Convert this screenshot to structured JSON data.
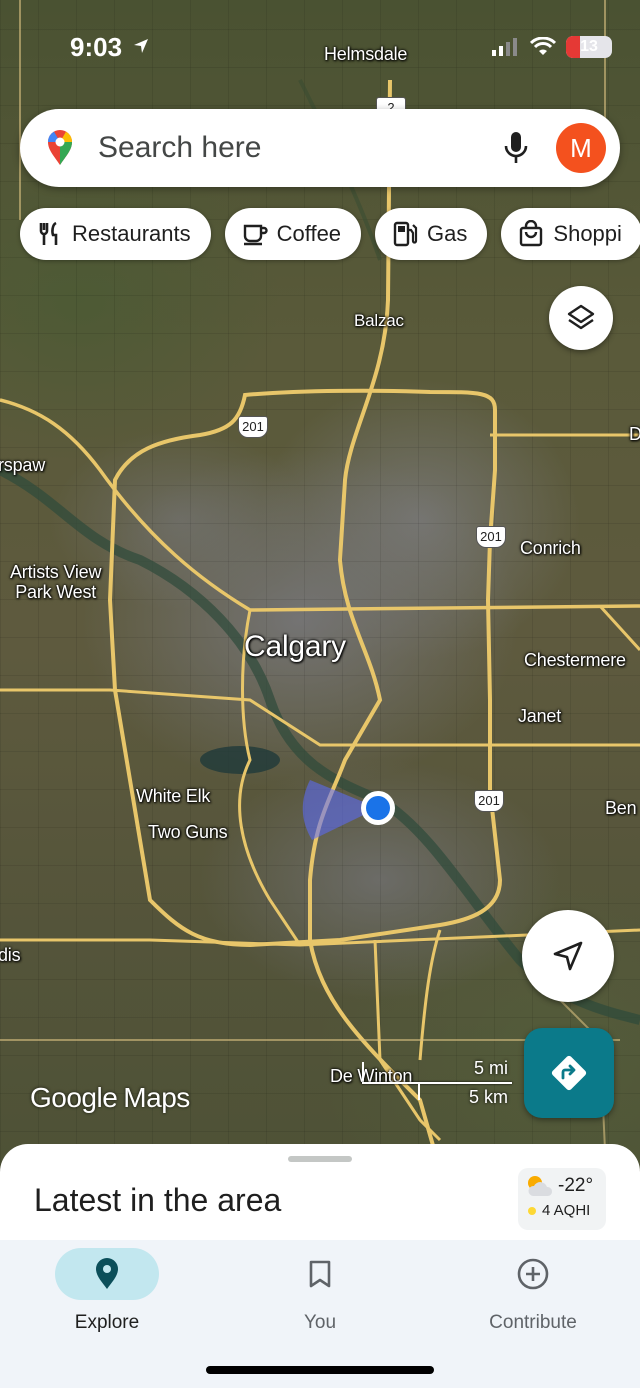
{
  "status_bar": {
    "time": "9:03",
    "battery": "13",
    "icons": [
      "location-arrow-icon",
      "signal-icon",
      "wifi-icon",
      "battery-icon"
    ]
  },
  "search": {
    "placeholder": "Search here",
    "avatar_letter": "M",
    "avatar_color": "#f4511e"
  },
  "chips": [
    {
      "label": "Restaurants",
      "icon": "restaurant-icon"
    },
    {
      "label": "Coffee",
      "icon": "coffee-icon"
    },
    {
      "label": "Gas",
      "icon": "gas-station-icon"
    },
    {
      "label": "Shoppi",
      "icon": "shopping-bag-icon"
    }
  ],
  "map": {
    "labels": {
      "helmsdale": "Helmsdale",
      "balzac": "Balzac",
      "arspaw": "rspaw",
      "conrich": "Conrich",
      "artists_view": "Artists View",
      "park_west": "Park West",
      "calgary": "Calgary",
      "chestermere": "Chestermere",
      "janet": "Janet",
      "white_elk": "White Elk",
      "two_guns": "Two Guns",
      "ben": "Ben",
      "dis": "dis",
      "de_winton": "De Winton",
      "d_edge": "D"
    },
    "highway_shields": {
      "top": "2",
      "north": "201",
      "east": "201",
      "south_east": "201"
    },
    "scale": {
      "mi": "5 mi",
      "km": "5 km"
    },
    "attribution": {
      "google": "Google",
      "maps": "Maps"
    },
    "location_dot_color": "#1a73e8"
  },
  "sheet": {
    "title": "Latest in the area",
    "weather": {
      "temp": "-22°",
      "aqi": "4 AQHI"
    }
  },
  "nav": {
    "items": [
      {
        "label": "Explore",
        "icon": "explore-pin-icon",
        "active": true
      },
      {
        "label": "You",
        "icon": "bookmark-icon",
        "active": false
      },
      {
        "label": "Contribute",
        "icon": "add-circle-icon",
        "active": false
      }
    ]
  },
  "colors": {
    "accent_teal": "#0b7a8a",
    "nav_active_bg": "#c2e7ef",
    "road": "#e8c66a"
  }
}
